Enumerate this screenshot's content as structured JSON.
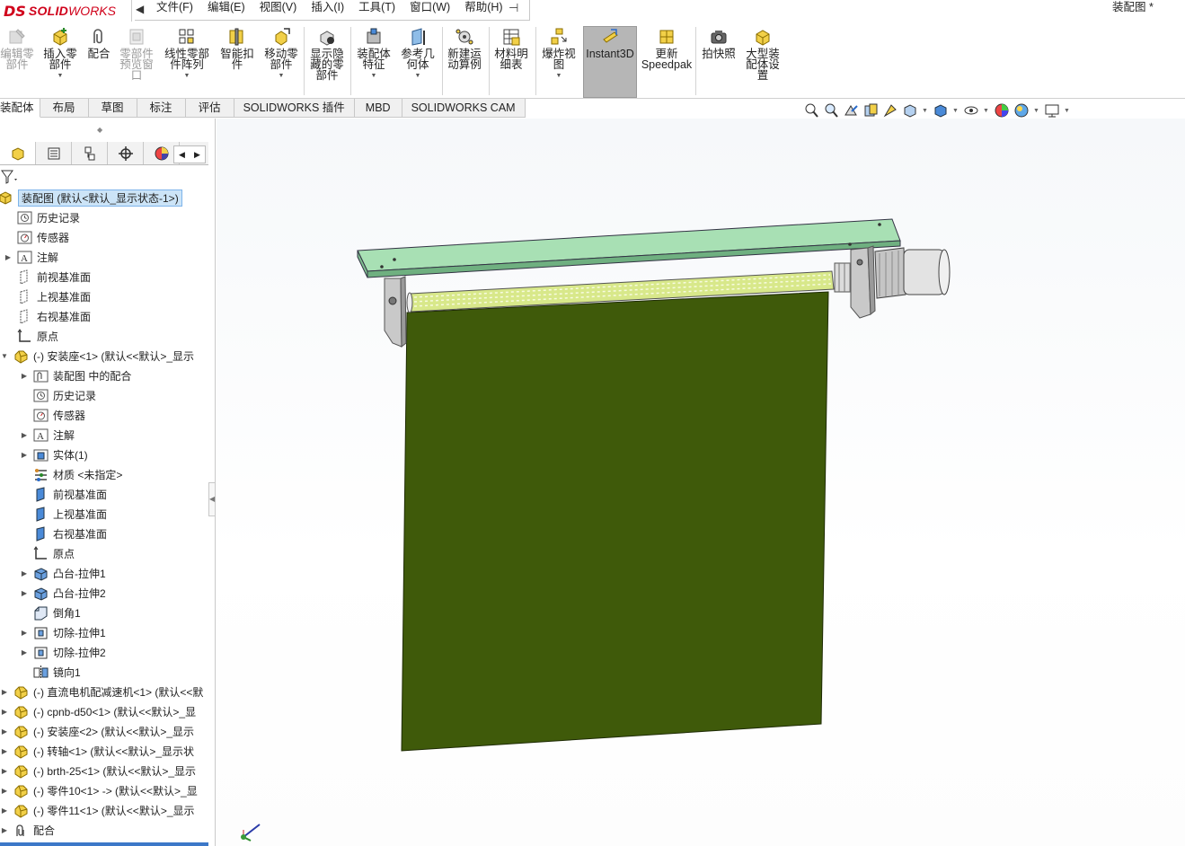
{
  "app": {
    "logo_ds": "DS",
    "logo_solid": "SOLID",
    "logo_works": "WORKS",
    "document_title": "装配图 *"
  },
  "menu": {
    "items": [
      "文件(F)",
      "编辑(E)",
      "视图(V)",
      "插入(I)",
      "工具(T)",
      "窗口(W)",
      "帮助(H)"
    ]
  },
  "ribbon": {
    "buttons": [
      {
        "label": "编辑零\n部件",
        "icon": "edit-component-icon",
        "enabled": false
      },
      {
        "label": "插入零\n部件",
        "icon": "insert-component-icon",
        "enabled": true
      },
      {
        "label": "配合",
        "icon": "mate-icon",
        "enabled": true
      },
      {
        "label": "零部件\n预览窗\n口",
        "icon": "component-preview-icon",
        "enabled": false
      },
      {
        "label": "线性零部\n件阵列",
        "icon": "linear-pattern-icon",
        "enabled": true
      },
      {
        "label": "智能扣\n件",
        "icon": "smart-fasteners-icon",
        "enabled": true
      },
      {
        "label": "移动零\n部件",
        "icon": "move-component-icon",
        "enabled": true
      },
      {
        "label": "显示隐\n藏的零\n部件",
        "icon": "show-hidden-icon",
        "enabled": true
      },
      {
        "label": "装配体\n特征",
        "icon": "assembly-features-icon",
        "enabled": true
      },
      {
        "label": "参考几\n何体",
        "icon": "reference-geometry-icon",
        "enabled": true
      },
      {
        "label": "新建运\n动算例",
        "icon": "motion-study-icon",
        "enabled": true
      },
      {
        "label": "材料明\n细表",
        "icon": "bom-icon",
        "enabled": true
      },
      {
        "label": "爆炸视\n图",
        "icon": "exploded-view-icon",
        "enabled": true
      },
      {
        "label": "Instant3D",
        "icon": "instant3d-icon",
        "enabled": true
      },
      {
        "label": "更新\nSpeedpak",
        "icon": "speedpak-icon",
        "enabled": true
      },
      {
        "label": "拍快照",
        "icon": "snapshot-icon",
        "enabled": true
      },
      {
        "label": "大型装\n配体设\n置",
        "icon": "large-assembly-icon",
        "enabled": true
      }
    ]
  },
  "tabs": [
    "装配体",
    "布局",
    "草图",
    "标注",
    "评估",
    "SOLIDWORKS 插件",
    "MBD",
    "SOLIDWORKS CAM"
  ],
  "feature_tree": {
    "root": "装配图 (默认<默认_显示状态-1>)",
    "top_items": [
      "历史记录",
      "传感器",
      "注解",
      "前视基准面",
      "上视基准面",
      "右视基准面",
      "原点"
    ],
    "part1": "(-) 安装座<1> (默认<<默认>_显示",
    "part1_children": [
      "装配图 中的配合",
      "历史记录",
      "传感器",
      "注解",
      "实体(1)",
      "材质 <未指定>",
      "前视基准面",
      "上视基准面",
      "右视基准面",
      "原点",
      "凸台-拉伸1",
      "凸台-拉伸2",
      "倒角1",
      "切除-拉伸1",
      "切除-拉伸2",
      "镜向1"
    ],
    "other_parts": [
      "(-) 直流电机配减速机<1> (默认<<默",
      "(-) cpnb-d50<1> (默认<<默认>_显",
      "(-) 安装座<2> (默认<<默认>_显示",
      "(-) 转轴<1> (默认<<默认>_显示状",
      "(-) brth-25<1> (默认<<默认>_显示",
      "(-) 零件10<1> -> (默认<<默认>_显",
      "(-) 零件11<1> (默认<<默认>_显示"
    ],
    "mates": "配合"
  },
  "colors": {
    "plate": "#a8e0b4",
    "curtain": "#3f5a0a",
    "roller": "#d8e88a",
    "bracket": "#c8c8c8",
    "motor": "#e0e0e0",
    "active_tab": "#b6b6b6",
    "selection": "#cce4f7"
  }
}
